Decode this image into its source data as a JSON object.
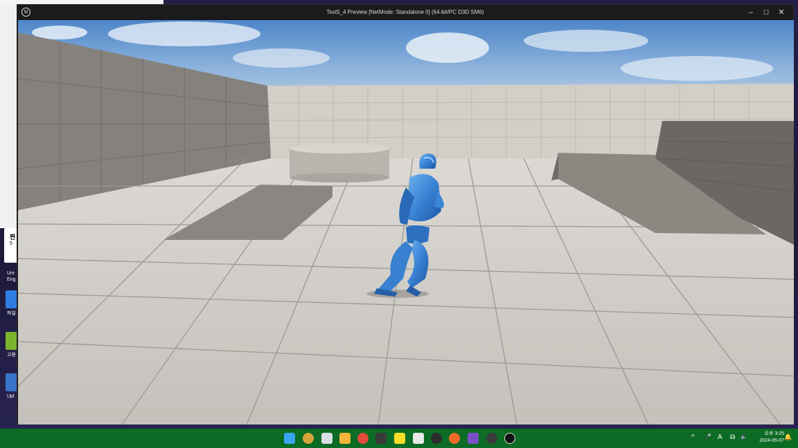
{
  "window": {
    "title": "Test5_4 Preview [NetMode: Standalone 0]  (64-bit/PC D3D SM6)",
    "logo": "U",
    "minimize": "–",
    "maximize": "☐",
    "close": "✕"
  },
  "desktop": {
    "labels": [
      "Unr",
      "Eng",
      "파일",
      "고용",
      "Upl"
    ],
    "notif_title": "찐",
    "notif_sub": "5"
  },
  "taskbar": {
    "apps": [
      "windows-start",
      "weather",
      "task-view",
      "file-explorer",
      "chrome",
      "terminal",
      "kakaotalk",
      "app-6",
      "github",
      "firefox",
      "visual-studio",
      "app-11",
      "unreal-engine"
    ],
    "tray": [
      "^",
      "🎤",
      "A",
      "⧉",
      "🔈"
    ],
    "clock_time": "오후 3:25",
    "clock_date": "2024-05-07"
  },
  "colors": {
    "taskbar": "#0c6b24",
    "window_title_bg": "#1b1b1b",
    "floor": "#c8c5c0",
    "character": "#3c86d6"
  }
}
